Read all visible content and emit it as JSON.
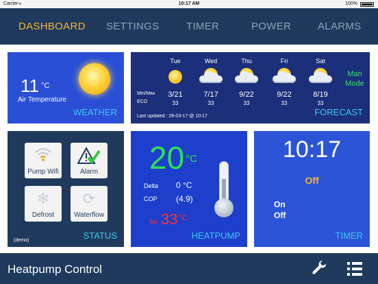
{
  "statusbar": {
    "carrier": "Carrier",
    "time": "10:17 AM",
    "battery": "100%"
  },
  "nav": {
    "tabs": [
      {
        "label": "DASHBOARD",
        "active": true
      },
      {
        "label": "SETTINGS"
      },
      {
        "label": "TIMER"
      },
      {
        "label": "POWER"
      },
      {
        "label": "ALARMS"
      }
    ]
  },
  "weather": {
    "temp": "11",
    "unit": "°C",
    "label": "Air Temperature",
    "title": "WEATHER",
    "icon": "sun-icon"
  },
  "forecast": {
    "title": "FORECAST",
    "minmax_label": "Min/Max",
    "eco_label": "ECO",
    "updated": "Last updated : 28-03-17 @ 10:17",
    "mode_line1": "Man",
    "mode_line2": "Mode",
    "days": [
      {
        "day": "Tue",
        "minmax": "3/21",
        "eco": "33",
        "icon": "sun-icon"
      },
      {
        "day": "Wed",
        "minmax": "7/17",
        "eco": "33",
        "icon": "partly-cloudy-icon"
      },
      {
        "day": "Thu",
        "minmax": "9/22",
        "eco": "33",
        "icon": "partly-cloudy-icon"
      },
      {
        "day": "Fri",
        "minmax": "9/22",
        "eco": "33",
        "icon": "partly-cloudy-icon"
      },
      {
        "day": "Sat",
        "minmax": "8/19",
        "eco": "33",
        "icon": "partly-cloudy-icon"
      }
    ]
  },
  "status": {
    "title": "STATUS",
    "demo": "(demo)",
    "tiles": [
      {
        "label": "Pump Wifi",
        "icon": "wifi-icon"
      },
      {
        "label": "Alarm",
        "icon": "alarm-check-icon"
      },
      {
        "label": "Defrost",
        "icon": "snowflake-icon"
      },
      {
        "label": "Waterflow",
        "icon": "waterflow-icon"
      }
    ]
  },
  "heatpump": {
    "title": "HEATPUMP",
    "temp": "20",
    "unit": "°C",
    "delta_label": "Delta",
    "delta_value": "0 °C",
    "cop_label": "COP",
    "cop_value": "(4.9)",
    "set_label": "Set",
    "set_value": "33",
    "set_unit": "°C",
    "icon": "thermometer-icon"
  },
  "timer": {
    "title": "TIMER",
    "clock": "10:17",
    "state": "Off",
    "on_label": "On",
    "off_label": "Off"
  },
  "bottombar": {
    "title": "Heatpump Control",
    "settings_icon": "wrench-icon",
    "menu_icon": "list-icon"
  },
  "colors": {
    "accent": "#f4b63a",
    "header": "#1f3a5c",
    "label_cyan": "#3ec8f0",
    "green": "#30e050",
    "red": "#ff3030"
  }
}
